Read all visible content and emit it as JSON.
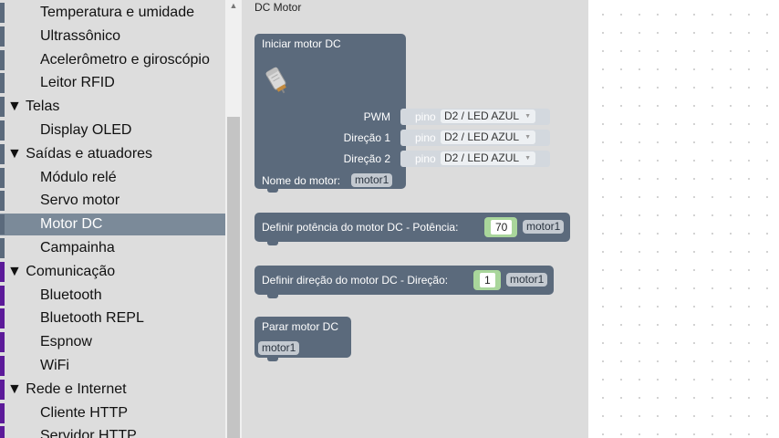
{
  "toolbox": {
    "items": [
      {
        "label": "Temperatura e umidade",
        "kind": "item",
        "color": "#5b6a7c"
      },
      {
        "label": "Ultrassônico",
        "kind": "item",
        "color": "#5b6a7c"
      },
      {
        "label": "Acelerômetro e giroscópio",
        "kind": "item",
        "color": "#5b6a7c"
      },
      {
        "label": "Leitor RFID",
        "kind": "item",
        "color": "#5b6a7c"
      },
      {
        "label": "▼ Telas",
        "kind": "cat",
        "color": "#5b6a7c"
      },
      {
        "label": "Display OLED",
        "kind": "item",
        "color": "#5b6a7c"
      },
      {
        "label": "▼ Saídas e atuadores",
        "kind": "cat",
        "color": "#5b6a7c"
      },
      {
        "label": "Módulo relé",
        "kind": "item",
        "color": "#5b6a7c"
      },
      {
        "label": "Servo motor",
        "kind": "item",
        "color": "#5b6a7c"
      },
      {
        "label": "Motor DC",
        "kind": "item",
        "color": "#5b6a7c",
        "selected": true
      },
      {
        "label": "Campainha",
        "kind": "item",
        "color": "#5b6a7c"
      },
      {
        "label": "▼ Comunicação",
        "kind": "cat",
        "color": "#5c1a99"
      },
      {
        "label": "Bluetooth",
        "kind": "item",
        "color": "#5c1a99"
      },
      {
        "label": "Bluetooth REPL",
        "kind": "item",
        "color": "#5c1a99"
      },
      {
        "label": "Espnow",
        "kind": "item",
        "color": "#5c1a99"
      },
      {
        "label": "WiFi",
        "kind": "item",
        "color": "#5c1a99"
      },
      {
        "label": "▼ Rede e Internet",
        "kind": "cat",
        "color": "#5c1a99"
      },
      {
        "label": "Cliente HTTP",
        "kind": "item",
        "color": "#5c1a99"
      },
      {
        "label": "Servidor HTTP",
        "kind": "item",
        "color": "#5c1a99"
      }
    ]
  },
  "scrollbar": {
    "up_arrow": "▲"
  },
  "flyout": {
    "title": "DC Motor",
    "block_color": "#5b6a7c",
    "start_block": {
      "title": "Iniciar motor DC",
      "inputs": [
        {
          "label": "PWM",
          "pin_label": "pino",
          "pin_value": "D2 / LED AZUL"
        },
        {
          "label": "Direção 1",
          "pin_label": "pino",
          "pin_value": "D2 / LED AZUL"
        },
        {
          "label": "Direção 2",
          "pin_label": "pino",
          "pin_value": "D2 / LED AZUL"
        }
      ],
      "name_label": "Nome do motor:",
      "name_value": "motor1"
    },
    "power_block": {
      "label": "Definir potência do motor DC  -  Potência:",
      "value": "70",
      "motor": "motor1"
    },
    "direction_block": {
      "label": "Definir direção do motor DC  -  Direção:",
      "value": "1",
      "motor": "motor1"
    },
    "stop_block": {
      "title": "Parar motor DC",
      "motor": "motor1"
    },
    "dropdown_arrow": "▼"
  }
}
